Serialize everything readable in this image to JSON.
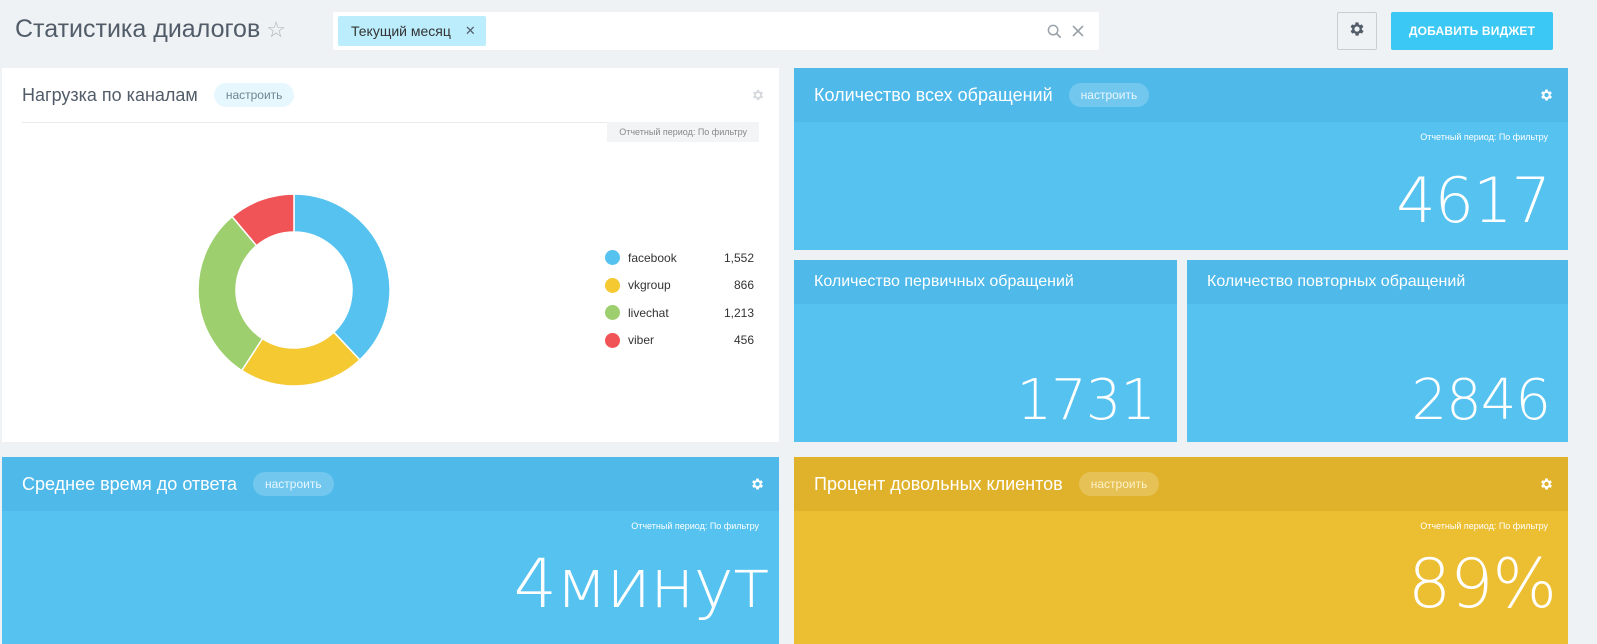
{
  "header": {
    "title": "Статистика диалогов",
    "filter_tag": "Текущий месяц",
    "add_widget_label": "ДОБАВИТЬ ВИДЖЕТ"
  },
  "widgets": {
    "channels": {
      "title": "Нагрузка по каналам",
      "configure": "настроить",
      "period": "Отчетный период: По фильтру"
    },
    "total": {
      "title": "Количество всех обращений",
      "configure": "настроить",
      "period": "Отчетный период: По фильтру",
      "value": "4617"
    },
    "primary": {
      "title": "Количество первичных обращений",
      "value": "1731"
    },
    "repeat": {
      "title": "Количество повторных обращений",
      "value": "2846"
    },
    "response_time": {
      "title": "Среднее время до ответа",
      "configure": "настроить",
      "period": "Отчетный период: По фильтру",
      "value": "4минут"
    },
    "satisfaction": {
      "title": "Процент довольных клиентов",
      "configure": "настроить",
      "period": "Отчетный период: По фильтру",
      "value": "89%"
    }
  },
  "colors": {
    "facebook": "#55c2f0",
    "vkgroup": "#f4c932",
    "livechat": "#9dcf6e",
    "viber": "#f15456"
  },
  "chart_data": {
    "type": "pie",
    "donut": true,
    "categories": [
      "facebook",
      "vkgroup",
      "livechat",
      "viber"
    ],
    "values": [
      1552,
      866,
      1213,
      456
    ],
    "labels": [
      "1,552",
      "866",
      "1,213",
      "456"
    ],
    "legend": "right"
  }
}
